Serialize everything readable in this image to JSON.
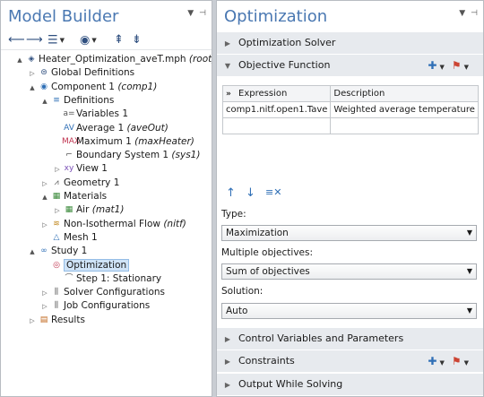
{
  "left": {
    "title": "Model Builder",
    "tree": [
      {
        "label": "Heater_Optimization_aveT.mph",
        "suffix": "(root)",
        "icon": "model-root-icon",
        "twisty": "▲"
      },
      {
        "label": "Global Definitions",
        "suffix": "",
        "icon": "globe-icon",
        "twisty": "▷"
      },
      {
        "label": "Component 1",
        "suffix": "(comp1)",
        "icon": "component-icon",
        "twisty": "▲"
      },
      {
        "label": "Definitions",
        "suffix": "",
        "icon": "definitions-icon",
        "twisty": "▲"
      },
      {
        "label": "Variables 1",
        "suffix": "",
        "icon": "variables-icon",
        "twisty": ""
      },
      {
        "label": "Average 1",
        "suffix": "(aveOut)",
        "icon": "average-icon",
        "twisty": ""
      },
      {
        "label": "Maximum 1",
        "suffix": "(maxHeater)",
        "icon": "maximum-icon",
        "twisty": ""
      },
      {
        "label": "Boundary System 1",
        "suffix": "(sys1)",
        "icon": "coordinate-system-icon",
        "twisty": ""
      },
      {
        "label": "View 1",
        "suffix": "",
        "icon": "view-icon",
        "twisty": "▷"
      },
      {
        "label": "Geometry 1",
        "suffix": "",
        "icon": "geometry-icon",
        "twisty": "▷"
      },
      {
        "label": "Materials",
        "suffix": "",
        "icon": "materials-icon",
        "twisty": "▲"
      },
      {
        "label": "Air",
        "suffix": "(mat1)",
        "icon": "material-icon",
        "twisty": "▷"
      },
      {
        "label": "Non-Isothermal Flow",
        "suffix": "(nitf)",
        "icon": "physics-icon",
        "twisty": "▷"
      },
      {
        "label": "Mesh 1",
        "suffix": "",
        "icon": "mesh-icon",
        "twisty": ""
      },
      {
        "label": "Study 1",
        "suffix": "",
        "icon": "study-icon",
        "twisty": "▲"
      },
      {
        "label": "Optimization",
        "suffix": "",
        "icon": "optimization-icon",
        "twisty": ""
      },
      {
        "label": "Step 1: Stationary",
        "suffix": "",
        "icon": "stationary-step-icon",
        "twisty": ""
      },
      {
        "label": "Solver Configurations",
        "suffix": "",
        "icon": "solver-icon",
        "twisty": "▷"
      },
      {
        "label": "Job Configurations",
        "suffix": "",
        "icon": "job-icon",
        "twisty": "▷"
      },
      {
        "label": "Results",
        "suffix": "",
        "icon": "results-icon",
        "twisty": "▷"
      }
    ],
    "glyphs": [
      "◈",
      "⊜",
      "◉",
      "≡",
      "a=",
      "AV",
      "MAX",
      "⌐",
      "xy",
      "⩘",
      "▦",
      "▦",
      "≋",
      "△",
      "∞",
      "◎",
      "⌒",
      "⫼",
      "⫼",
      "▤"
    ]
  },
  "right": {
    "title": "Optimization",
    "sections": {
      "solver": "Optimization Solver",
      "objective": "Objective Function",
      "control": "Control Variables and Parameters",
      "constraints": "Constraints",
      "output": "Output While Solving"
    },
    "table": {
      "headers": [
        "Expression",
        "Description"
      ],
      "rows": [
        [
          "comp1.nitf.open1.Tave",
          "Weighted average temperature"
        ]
      ]
    },
    "type_label": "Type:",
    "type_value": "Maximization",
    "multi_label": "Multiple objectives:",
    "multi_value": "Sum of objectives",
    "solution_label": "Solution:",
    "solution_value": "Auto"
  },
  "colors": {
    "accent": "#4a78b2",
    "panel_bg": "#ffffff",
    "section_bg": "#e7eaee",
    "selection": "#cfe3f7"
  }
}
